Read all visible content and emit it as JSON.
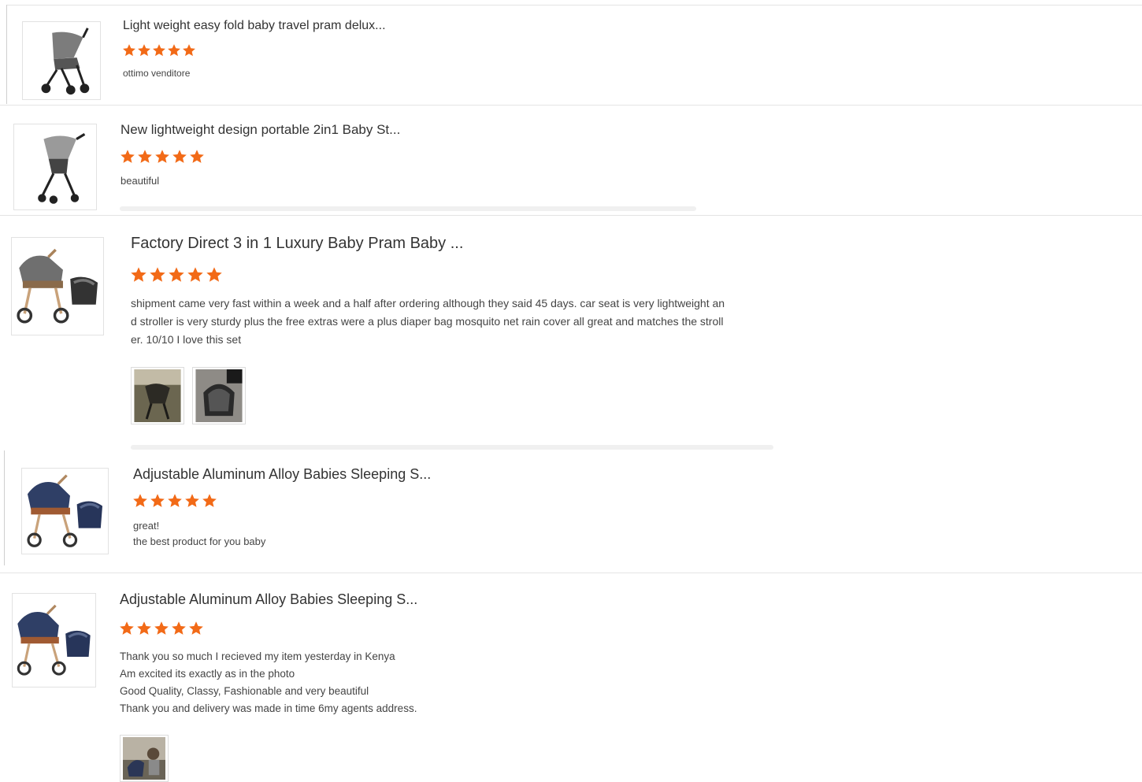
{
  "colors": {
    "star": "#f26a17",
    "divider": "#e4e4e4"
  },
  "reviews": [
    {
      "product_title": "Light weight easy fold baby travel pram delux...",
      "rating": 5,
      "max_rating": 5,
      "lines": [
        "ottimo venditore"
      ],
      "product_image_icon": "grey-stroller-icon"
    },
    {
      "product_title": "New lightweight design portable 2in1 Baby St...",
      "rating": 5,
      "max_rating": 5,
      "lines": [
        "beautiful"
      ],
      "product_image_icon": "grey-stroller-icon"
    },
    {
      "product_title": "Factory Direct 3 in 1 Luxury Baby Pram Baby ...",
      "rating": 5,
      "max_rating": 5,
      "lines": [
        "shipment came very fast within a week and a half after ordering although they said 45 days. car seat is very lightweight an",
        "d stroller is very sturdy plus the free extras were a plus diaper bag mosquito net rain cover all great and matches the stroll",
        "er. 10/10 I love this set"
      ],
      "product_image_icon": "pram-with-carseat-icon",
      "photos": [
        "customer-photo-stroller",
        "customer-photo-carseat"
      ]
    },
    {
      "product_title": "Adjustable Aluminum Alloy Babies Sleeping S...",
      "rating": 5,
      "max_rating": 5,
      "lines": [
        "great!",
        "the best product for you baby"
      ],
      "product_image_icon": "navy-pram-with-carseat-icon"
    },
    {
      "product_title": "Adjustable Aluminum Alloy Babies Sleeping S...",
      "rating": 5,
      "max_rating": 5,
      "lines": [
        "Thank you so much I recieved my item yesterday in Kenya",
        "Am excited its exactly as in the photo",
        "Good Quality, Classy, Fashionable and very beautiful",
        "Thank you and delivery was made in time 6my agents address."
      ],
      "product_image_icon": "navy-pram-with-carseat-icon",
      "photos": [
        "customer-photo-delivery"
      ]
    }
  ]
}
